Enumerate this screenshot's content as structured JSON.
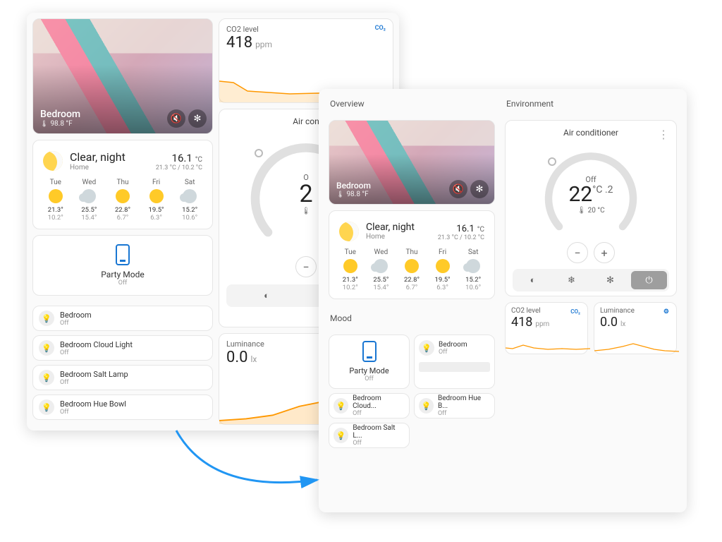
{
  "room": {
    "name": "Bedroom",
    "temp": "98.8 °F"
  },
  "weather": {
    "condition": "Clear, night",
    "location": "Home",
    "temp": "16.1",
    "temp_unit": "°C",
    "range": "21.3 °C / 10.2 °C",
    "days": [
      {
        "d": "Tue",
        "hi": "21.3°",
        "lo": "10.2°",
        "icon": "sun"
      },
      {
        "d": "Wed",
        "hi": "25.5°",
        "lo": "15.4°",
        "icon": "cloud"
      },
      {
        "d": "Thu",
        "hi": "22.8°",
        "lo": "6.7°",
        "icon": "sun"
      },
      {
        "d": "Fri",
        "hi": "19.5°",
        "lo": "6.3°",
        "icon": "sun"
      },
      {
        "d": "Sat",
        "hi": "15.2°",
        "lo": "10.6°",
        "icon": "cloud"
      }
    ]
  },
  "party": {
    "label": "Party Mode",
    "state": "Off"
  },
  "lights": [
    {
      "name": "Bedroom",
      "state": "Off"
    },
    {
      "name": "Bedroom Cloud Light",
      "state": "Off"
    },
    {
      "name": "Bedroom Salt Lamp",
      "state": "Off"
    },
    {
      "name": "Bedroom Hue Bowl",
      "state": "Off"
    }
  ],
  "mood_lights": [
    {
      "name": "Bedroom",
      "state": "Off"
    },
    {
      "name": "Bedroom Cloud...",
      "state": "Off"
    },
    {
      "name": "Bedroom Hue B...",
      "state": "Off"
    },
    {
      "name": "Bedroom Salt L...",
      "state": "Off"
    }
  ],
  "co2": {
    "label": "CO2 level",
    "value": "418",
    "unit": "ppm",
    "badge": "CO₂"
  },
  "lum": {
    "label": "Luminance",
    "value": "0.0",
    "unit": "lx"
  },
  "ac": {
    "title": "Air conditioner",
    "state": "Off",
    "temp": "22",
    "frac": "°C .2",
    "sub_icon": "🌡",
    "sub": "20 °C"
  },
  "sections": {
    "overview": "Overview",
    "environment": "Environment",
    "mood": "Mood"
  },
  "chart_data": [
    {
      "type": "line",
      "title": "CO2 level",
      "ylabel": "ppm",
      "ylim": [
        380,
        500
      ],
      "x": [
        0,
        1,
        2,
        3,
        4,
        5,
        6,
        7,
        8,
        9,
        10,
        11
      ],
      "values": [
        460,
        455,
        430,
        420,
        415,
        418,
        416,
        414,
        418,
        420,
        418,
        418
      ]
    },
    {
      "type": "line",
      "title": "Luminance",
      "ylabel": "lx",
      "ylim": [
        0,
        20
      ],
      "x": [
        0,
        1,
        2,
        3,
        4,
        5,
        6,
        7,
        8,
        9,
        10,
        11
      ],
      "values": [
        2,
        3,
        4,
        8,
        12,
        14,
        10,
        6,
        3,
        2,
        1,
        0
      ]
    }
  ]
}
